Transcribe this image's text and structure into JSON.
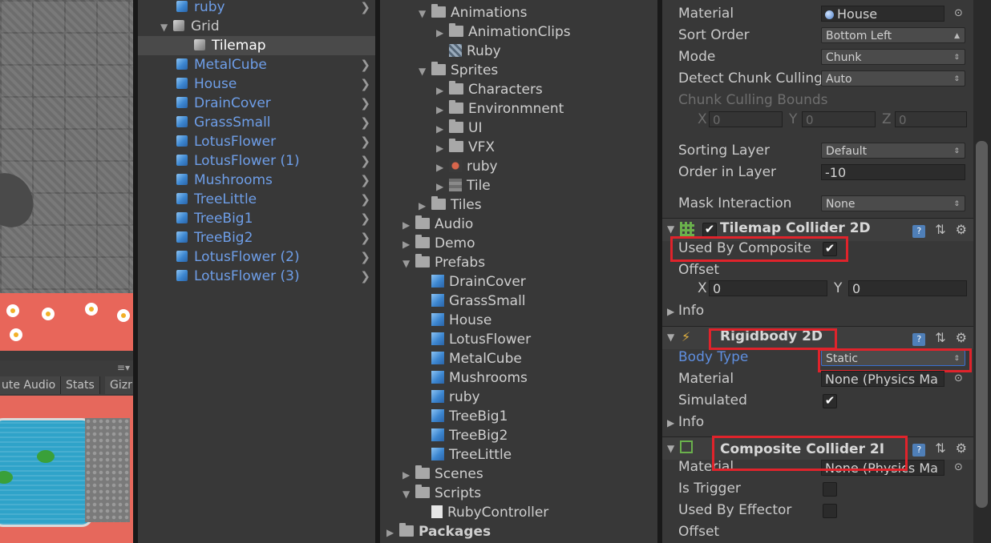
{
  "scene": {
    "tabs": [
      "ute Audio",
      "Stats",
      "Gizr"
    ]
  },
  "hierarchy": {
    "items": [
      {
        "label": "ruby",
        "blue": true,
        "chevron": true
      },
      {
        "label": "Grid",
        "blue": false,
        "expanded": true
      },
      {
        "label": "Tilemap",
        "blue": false,
        "selected": true
      },
      {
        "label": "MetalCube",
        "blue": true,
        "chevron": true
      },
      {
        "label": "House",
        "blue": true,
        "chevron": true
      },
      {
        "label": "DrainCover",
        "blue": true,
        "chevron": true
      },
      {
        "label": "GrassSmall",
        "blue": true,
        "chevron": true
      },
      {
        "label": "LotusFlower",
        "blue": true,
        "chevron": true
      },
      {
        "label": "LotusFlower (1)",
        "blue": true,
        "chevron": true
      },
      {
        "label": "Mushrooms",
        "blue": true,
        "chevron": true
      },
      {
        "label": "TreeLittle",
        "blue": true,
        "chevron": true
      },
      {
        "label": "TreeBig1",
        "blue": true,
        "chevron": true
      },
      {
        "label": "TreeBig2",
        "blue": true,
        "chevron": true
      },
      {
        "label": "LotusFlower (2)",
        "blue": true,
        "chevron": true
      },
      {
        "label": "LotusFlower (3)",
        "blue": true,
        "chevron": true
      }
    ]
  },
  "project": {
    "items": [
      {
        "label": "Animations",
        "icon": "folder-icon",
        "arrow": "▼"
      },
      {
        "label": "AnimationClips",
        "icon": "folder-icon",
        "arrow": "▶"
      },
      {
        "label": "Ruby",
        "icon": "animator-icon",
        "arrow": ""
      },
      {
        "label": "Sprites",
        "icon": "folder-icon",
        "arrow": "▼"
      },
      {
        "label": "Characters",
        "icon": "folder-icon",
        "arrow": "▶"
      },
      {
        "label": "Environmnent",
        "icon": "folder-icon",
        "arrow": "▶"
      },
      {
        "label": "UI",
        "icon": "folder-icon",
        "arrow": "▶"
      },
      {
        "label": "VFX",
        "icon": "folder-icon",
        "arrow": "▶"
      },
      {
        "label": "ruby",
        "icon": "sprite-icon",
        "arrow": "▶"
      },
      {
        "label": "Tile",
        "icon": "tile-icon",
        "arrow": "▶"
      },
      {
        "label": "Tiles",
        "icon": "folder-icon",
        "arrow": "▶"
      },
      {
        "label": "Audio",
        "icon": "folder-icon",
        "arrow": "▶"
      },
      {
        "label": "Demo",
        "icon": "folder-icon",
        "arrow": "▶"
      },
      {
        "label": "Prefabs",
        "icon": "folder-icon",
        "arrow": "▼"
      },
      {
        "label": "DrainCover",
        "icon": "prefab-icon",
        "arrow": ""
      },
      {
        "label": "GrassSmall",
        "icon": "prefab-icon",
        "arrow": ""
      },
      {
        "label": "House",
        "icon": "prefab-icon",
        "arrow": ""
      },
      {
        "label": "LotusFlower",
        "icon": "prefab-icon",
        "arrow": ""
      },
      {
        "label": "MetalCube",
        "icon": "prefab-icon",
        "arrow": ""
      },
      {
        "label": "Mushrooms",
        "icon": "prefab-icon",
        "arrow": ""
      },
      {
        "label": "ruby",
        "icon": "prefab-icon",
        "arrow": ""
      },
      {
        "label": "TreeBig1",
        "icon": "prefab-icon",
        "arrow": ""
      },
      {
        "label": "TreeBig2",
        "icon": "prefab-icon",
        "arrow": ""
      },
      {
        "label": "TreeLittle",
        "icon": "prefab-icon",
        "arrow": ""
      },
      {
        "label": "Scenes",
        "icon": "folder-icon",
        "arrow": "▶"
      },
      {
        "label": "Scripts",
        "icon": "folder-icon",
        "arrow": "▼"
      },
      {
        "label": "RubyController",
        "icon": "script-icon",
        "arrow": ""
      },
      {
        "label": "Packages",
        "icon": "folder-icon",
        "arrow": "▶"
      }
    ]
  },
  "inspector": {
    "renderer": {
      "material_label": "Material",
      "material_value": "House",
      "sort_order_label": "Sort Order",
      "sort_order_value": "Bottom Left",
      "mode_label": "Mode",
      "mode_value": "Chunk",
      "detect_label": "Detect Chunk Culling",
      "detect_value": "Auto",
      "bounds_label": "Chunk Culling Bounds",
      "bounds_x_label": "X",
      "bounds_x": "0",
      "bounds_y_label": "Y",
      "bounds_y": "0",
      "bounds_z_label": "Z",
      "bounds_z": "0",
      "sorting_layer_label": "Sorting Layer",
      "sorting_layer_value": "Default",
      "order_label": "Order in Layer",
      "order_value": "-10",
      "mask_label": "Mask Interaction",
      "mask_value": "None"
    },
    "tilemap_collider": {
      "title": "Tilemap Collider 2D",
      "used_by_composite_label": "Used By Composite",
      "used_by_composite_checked": "✔",
      "offset_label": "Offset",
      "offset_x_label": "X",
      "offset_x": "0",
      "offset_y_label": "Y",
      "offset_y": "0",
      "info_label": "Info"
    },
    "rigidbody": {
      "title": "Rigidbody 2D",
      "body_type_label": "Body Type",
      "body_type_value": "Static",
      "material_label": "Material",
      "material_value": "None (Physics Ma",
      "simulated_label": "Simulated",
      "simulated_checked": "✔",
      "info_label": "Info"
    },
    "composite": {
      "title": "Composite Collider 2I",
      "material_label": "Material",
      "material_value": "None (Physics Ma",
      "is_trigger_label": "Is Trigger",
      "used_by_effector_label": "Used By Effector",
      "offset_label": "Offset"
    }
  },
  "colors": {
    "highlight_box": "#e0232b",
    "prefab_blue": "#6e9ee8",
    "body_type_blue": "#5f8fe0"
  }
}
